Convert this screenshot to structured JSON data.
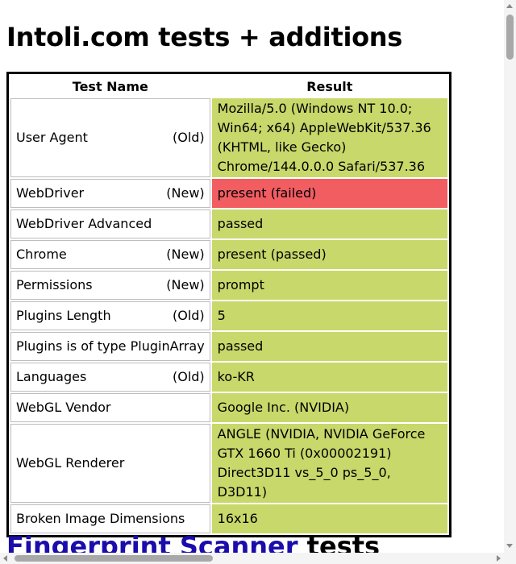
{
  "page": {
    "title": "Intoli.com tests + additions",
    "next_heading_link": "Fingerprint Scanner",
    "next_heading_suffix": " tests"
  },
  "table": {
    "col_name": "Test Name",
    "col_result": "Result",
    "rows": [
      {
        "name": "User Agent",
        "tag": "(Old)",
        "result": "Mozilla/5.0 (Windows NT 10.0; Win64; x64) AppleWebKit/537.36 (KHTML, like Gecko) Chrome/144.0.0.0 Safari/537.36",
        "status": "passed"
      },
      {
        "name": "WebDriver",
        "tag": "(New)",
        "result": "present (failed)",
        "status": "failed"
      },
      {
        "name": "WebDriver Advanced",
        "tag": "",
        "result": "passed",
        "status": "passed"
      },
      {
        "name": "Chrome",
        "tag": "(New)",
        "result": "present (passed)",
        "status": "passed"
      },
      {
        "name": "Permissions",
        "tag": "(New)",
        "result": "prompt",
        "status": "passed"
      },
      {
        "name": "Plugins Length",
        "tag": "(Old)",
        "result": "5",
        "status": "passed"
      },
      {
        "name": "Plugins is of type PluginArray",
        "tag": "",
        "result": "passed",
        "status": "passed"
      },
      {
        "name": "Languages",
        "tag": "(Old)",
        "result": "ko-KR",
        "status": "passed"
      },
      {
        "name": "WebGL Vendor",
        "tag": "",
        "result": "Google Inc. (NVIDIA)",
        "status": "passed"
      },
      {
        "name": "WebGL Renderer",
        "tag": "",
        "result": "ANGLE (NVIDIA, NVIDIA GeForce GTX 1660 Ti (0x00002191) Direct3D11 vs_5_0 ps_5_0, D3D11)",
        "status": "passed"
      },
      {
        "name": "Broken Image Dimensions",
        "tag": "",
        "result": "16x16",
        "status": "passed"
      }
    ]
  },
  "colors": {
    "passed": "#c8d86a",
    "failed": "#f25d62",
    "link": "#1a0dab"
  }
}
